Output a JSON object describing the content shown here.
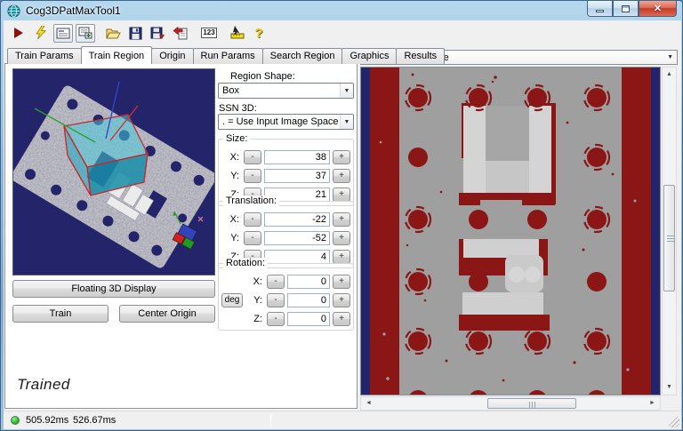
{
  "window": {
    "title": "Cog3DPatMaxTool1"
  },
  "toolbar": {
    "icons": [
      "run-icon",
      "lightning-icon",
      "display-panel-icon",
      "add-display-panel-icon",
      "open-folder-icon",
      "save-icon",
      "save-arrow-icon",
      "document-arrow-icon",
      "numeric-123-icon",
      "ruler-pointer-icon",
      "help-icon"
    ],
    "numeric_icon_label": "123",
    "help_glyph": "?"
  },
  "tabs": {
    "items": [
      "Train Params",
      "Train Region",
      "Origin",
      "Run Params",
      "Search Region",
      "Graphics",
      "Results"
    ],
    "active": "Train Region"
  },
  "left": {
    "floating_3d_button": "Floating 3D Display",
    "train_button": "Train",
    "center_origin_button": "Center Origin",
    "trained_status": "Trained"
  },
  "form": {
    "region_shape_label": "Region Shape:",
    "region_shape_value": "Box",
    "ssn3d_label": "SSN 3D:",
    "ssn3d_value": ". = Use Input Image Space",
    "minus": "-",
    "plus": "+",
    "size": {
      "label": "Size:",
      "x_label": "X:",
      "x": "38",
      "y_label": "Y:",
      "y": "37",
      "z_label": "Z:",
      "z": "21"
    },
    "translation": {
      "label": "Translation:",
      "x_label": "X:",
      "x": "-22",
      "y_label": "Y:",
      "y": "-52",
      "z_label": "Z:",
      "z": "4"
    },
    "rotation": {
      "label": "Rotation:",
      "deg_button": "deg",
      "x_label": "X:",
      "x": "0",
      "y_label": "Y:",
      "y": "0",
      "z_label": "Z:",
      "z": "0"
    }
  },
  "right": {
    "image_selector_value": "Current.InputImage"
  },
  "status": {
    "time_1": "505.92ms",
    "time_2": "526.67ms"
  },
  "colors": {
    "maroon": "#8a1616",
    "image_gray": "#9f9f9f",
    "structure_gray": "#d2d2d2",
    "navy": "#23246a",
    "box_cyan": "#49c8d8",
    "wireframe_red": "#cc2626",
    "status_green": "#2db82d",
    "aero_blue": "#8fb8da"
  }
}
